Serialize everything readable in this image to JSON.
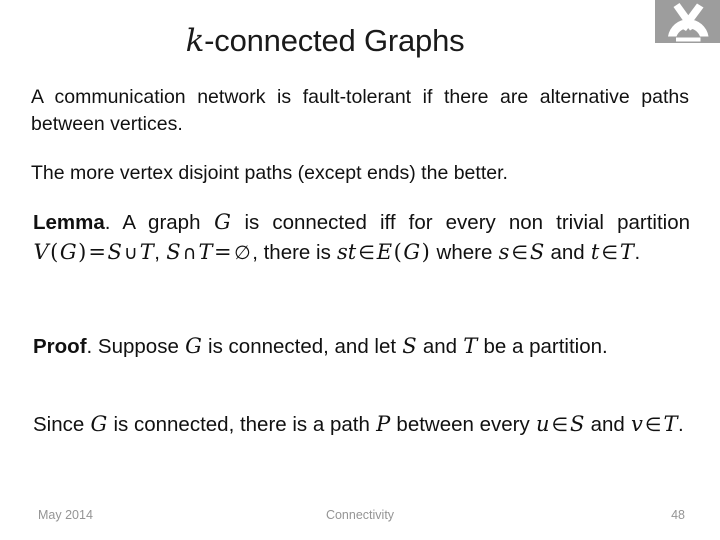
{
  "slide": {
    "title": {
      "variable": "k",
      "rest": "-connected Graphs"
    },
    "logo": {
      "icon_name": "microscope-icon",
      "background_color": "#9d9d9d",
      "glyph_color": "#ffffff"
    },
    "paragraphs": [
      "A communication network is fault-tolerant if there are alternative paths between vertices.",
      "The more vertex disjoint paths (except ends) the better."
    ],
    "lemma": {
      "keyword": "Lemma",
      "keyword_suffix": ".",
      "t1": " A graph ",
      "v1": "G",
      "t2": " is connected iff for every non trivial partition ",
      "v2": "V",
      "p1": "(",
      "v3": "G",
      "p2": ")",
      "eq1": "=",
      "v4": "S",
      "cup": "∪",
      "v5": "T",
      "comma1": ", ",
      "v6": "S",
      "cap": "∩",
      "v7": "T",
      "eq2": "=",
      "emptyset": "∅",
      "t3": ", there is ",
      "v8": "st",
      "isin1": "∈",
      "v9": "E",
      "p3": "(",
      "v10": "G",
      "p4": ")",
      "t4": " where ",
      "v11": "s",
      "isin2": "∈",
      "v12": "S",
      "t5": " and ",
      "v13": "t",
      "isin3": "∈",
      "v14": "T",
      "t6": "."
    },
    "proof": {
      "keyword": "Proof",
      "keyword_suffix": ".",
      "t1": " Suppose ",
      "v1": "G",
      "t2": " is connected, and let ",
      "v2": "S",
      "t3": " and ",
      "v3": "T",
      "t4": " be a partition."
    },
    "since": {
      "t1": "Since ",
      "v1": "G",
      "t2": " is connected, there is a path ",
      "v2": "P",
      "t3": " between every ",
      "v3": "u",
      "isin1": "∈",
      "v4": "S",
      "t4": " and ",
      "v5": "v",
      "isin2": "∈",
      "v6": "T",
      "t5": "."
    },
    "footer": {
      "date": "May 2014",
      "section": "Connectivity",
      "page_number": "48",
      "color": "#959595"
    }
  }
}
